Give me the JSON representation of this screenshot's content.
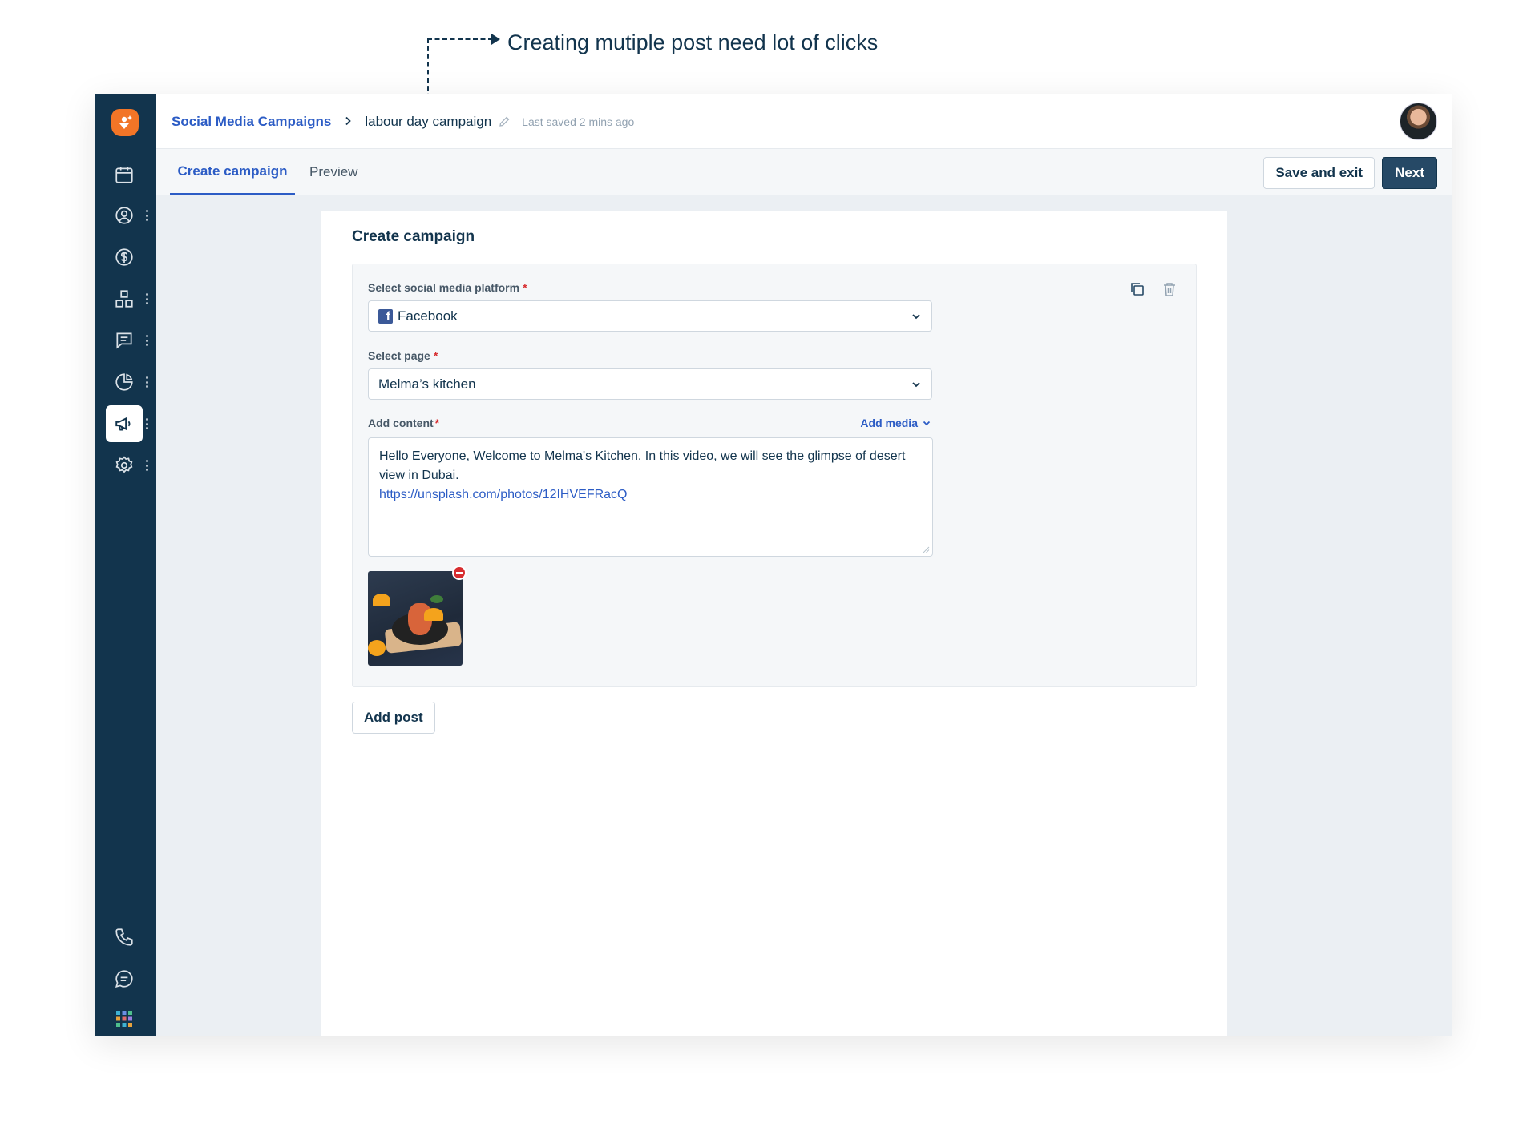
{
  "annotation": {
    "text": "Creating mutiple post need lot of clicks"
  },
  "breadcrumb": {
    "parent": "Social Media Campaigns",
    "current": "labour day campaign",
    "last_saved": "Last saved 2 mins ago"
  },
  "tabs": [
    {
      "label": "Create campaign",
      "active": true
    },
    {
      "label": "Preview",
      "active": false
    }
  ],
  "actions": {
    "save_exit": "Save and exit",
    "next": "Next"
  },
  "form": {
    "title": "Create campaign",
    "platform": {
      "label": "Select social media platform",
      "required": "*",
      "value": "Facebook"
    },
    "page": {
      "label": "Select page",
      "required": "*",
      "value": "Melma’s kitchen"
    },
    "content": {
      "label": "Add content",
      "required": "*",
      "add_media": "Add media",
      "text": "Hello Everyone, Welcome to Melma's Kitchen. In this video, we will see the glimpse of desert view in Dubai.",
      "link": "https://unsplash.com/photos/12IHVEFRacQ"
    },
    "add_post": "Add post"
  },
  "sidebar": {
    "items": [
      {
        "icon": "calendar-icon",
        "has_more": false
      },
      {
        "icon": "contact-icon",
        "has_more": true
      },
      {
        "icon": "dollar-icon",
        "has_more": false
      },
      {
        "icon": "grid-icon",
        "has_more": true
      },
      {
        "icon": "chat-icon",
        "has_more": true
      },
      {
        "icon": "pie-chart-icon",
        "has_more": true
      },
      {
        "icon": "megaphone-icon",
        "has_more": true,
        "active": true
      },
      {
        "icon": "settings-icon",
        "has_more": true
      }
    ],
    "bottom": [
      "phone-icon",
      "message-icon",
      "apps-grid-icon"
    ]
  },
  "colors": {
    "sidebar": "#12344d",
    "accent": "#2c5cc5",
    "brand": "#f27527",
    "danger": "#d72d30"
  }
}
